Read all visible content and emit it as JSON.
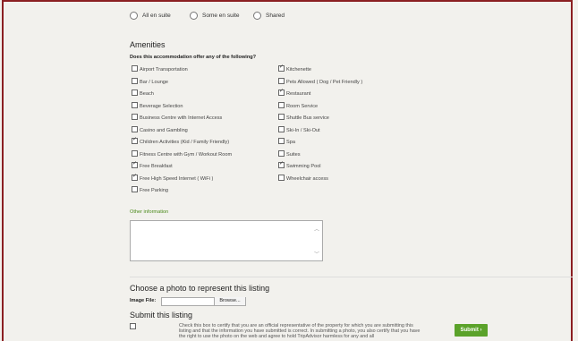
{
  "bathroom": {
    "options": [
      {
        "label": "All en suite"
      },
      {
        "label": "Some en suite"
      },
      {
        "label": "Shared"
      }
    ]
  },
  "amenities": {
    "heading": "Amenities",
    "question": "Does this accommodation offer any of the following?",
    "left": [
      {
        "label": "Airport Transportation",
        "checked": false
      },
      {
        "label": "Bar / Lounge",
        "checked": false
      },
      {
        "label": "Beach",
        "checked": false
      },
      {
        "label": "Beverage Selection",
        "checked": false
      },
      {
        "label": "Business Centre with Internet Access",
        "checked": false
      },
      {
        "label": "Casino and Gambling",
        "checked": false
      },
      {
        "label": "Children Activities (Kid / Family Friendly)",
        "checked": true
      },
      {
        "label": "Fitness Centre with Gym / Workout Room",
        "checked": false
      },
      {
        "label": "Free Breakfast",
        "checked": true
      },
      {
        "label": "Free High Speed Internet ( WiFi )",
        "checked": true
      },
      {
        "label": "Free Parking",
        "checked": false
      }
    ],
    "right": [
      {
        "label": "Kitchenette",
        "checked": true
      },
      {
        "label": "Pets Allowed ( Dog / Pet Friendly )",
        "checked": false
      },
      {
        "label": "Restaurant",
        "checked": true
      },
      {
        "label": "Room Service",
        "checked": false
      },
      {
        "label": "Shuttle Bus service",
        "checked": false
      },
      {
        "label": "Ski-In / Ski-Out",
        "checked": false
      },
      {
        "label": "Spa",
        "checked": false
      },
      {
        "label": "Suites",
        "checked": false
      },
      {
        "label": "Swimming Pool",
        "checked": true
      },
      {
        "label": "Wheelchair access",
        "checked": false
      }
    ]
  },
  "other": {
    "label": "Other information"
  },
  "photo": {
    "title": "Choose a photo to represent this listing",
    "file_label": "Image File:",
    "browse_label": "Browse..."
  },
  "submit": {
    "title": "Submit this listing",
    "cert_text": "Check this box to certify that you are an official representative of the property for which you are submitting this listing and that the information you have submitted is correct. In submitting a photo, you also certify that you have the right to use the photo on the web and agree to hold TripAdvisor harmless for any and all",
    "button_label": "Submit",
    "button_arrow": "›"
  },
  "colors": {
    "frame": "#8b1f22",
    "accent_green": "#5ba22a",
    "link_green": "#4a8a1a"
  }
}
